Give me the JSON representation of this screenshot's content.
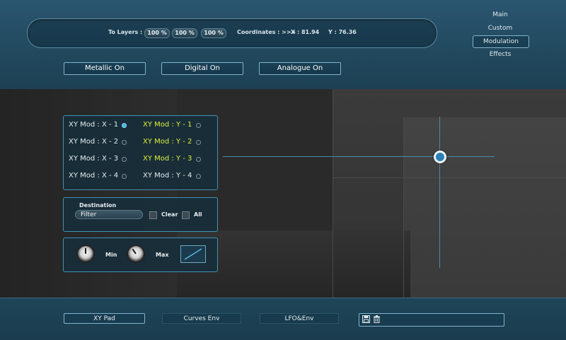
{
  "info_bar": {
    "to_layers_label": "To Layers  :",
    "layers": [
      "100 %",
      "100 %",
      "100 %"
    ],
    "coordinates_label": "Coordinates : >>>",
    "x_value": "X : 81.94",
    "y_value": "Y : 76.36"
  },
  "nav": {
    "items": [
      {
        "label": "Main"
      },
      {
        "label": "Custom"
      },
      {
        "label": "Modulation",
        "active": true
      },
      {
        "label": "Effects"
      }
    ]
  },
  "modes": {
    "metallic": "Metallic On",
    "digital": "Digital On",
    "analogue": "Analogue On"
  },
  "xy_mod": {
    "x": [
      {
        "label": "XY Mod : X - 1",
        "active": true
      },
      {
        "label": "XY Mod : X - 2",
        "active": false
      },
      {
        "label": "XY Mod : X - 3",
        "active": false
      },
      {
        "label": "XY Mod : X - 4",
        "active": false
      }
    ],
    "y": [
      {
        "label": "XY Mod : Y - 1",
        "active": true
      },
      {
        "label": "XY Mod : Y - 2",
        "active": true
      },
      {
        "label": "XY Mod : Y - 3",
        "active": true
      },
      {
        "label": "XY Mod : Y - 4",
        "active": false
      }
    ]
  },
  "destination": {
    "label": "Destination",
    "value": "Filter",
    "clear_label": "Clear",
    "all_label": "All"
  },
  "range": {
    "min_label": "Min",
    "max_label": "Max"
  },
  "xy_pad": {
    "x": 81.94,
    "y": 76.36
  },
  "tabs": {
    "xy_pad": "XY Pad",
    "curves_env": "Curves Env",
    "lfo_env": "LFO&Env"
  },
  "icons": {
    "save": "save-icon",
    "delete": "trash-icon"
  },
  "colors": {
    "accent": "#43b4e6",
    "active_text": "#d9f03a",
    "panel_border": "#3f93b0"
  }
}
